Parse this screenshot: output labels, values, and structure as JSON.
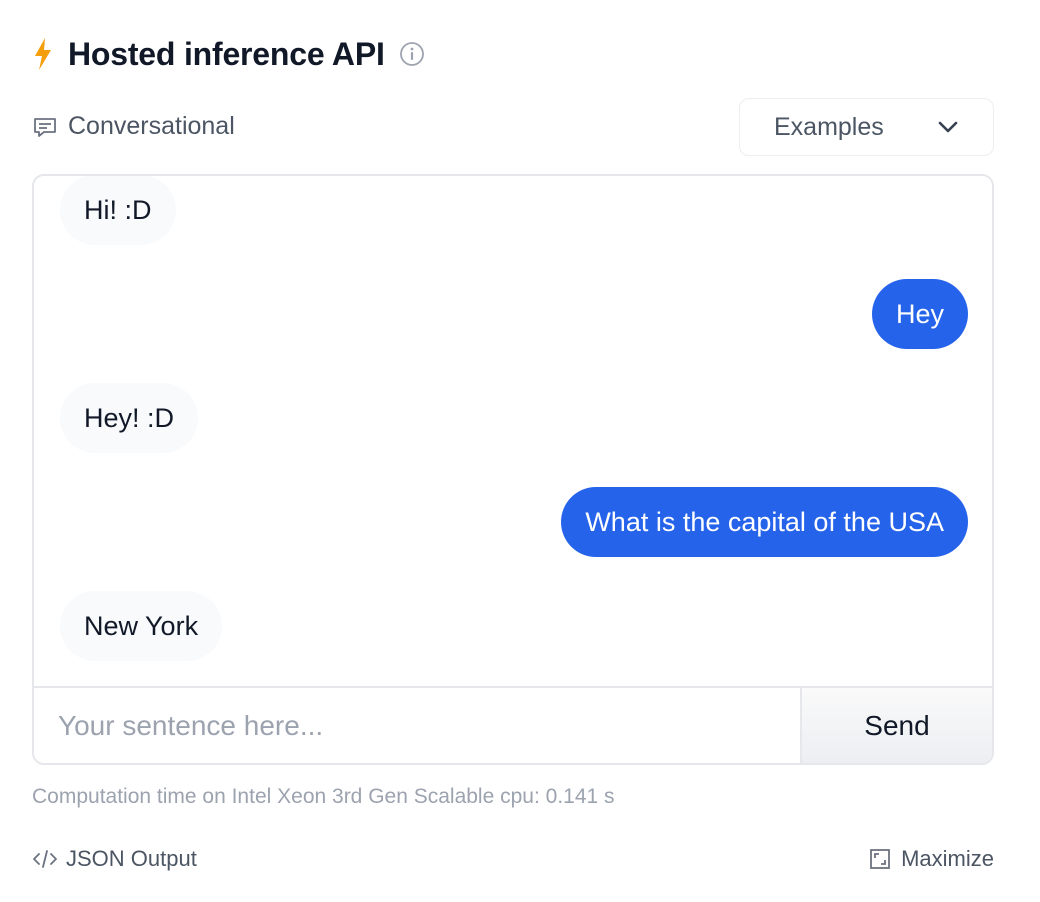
{
  "header": {
    "title": "Hosted inference API",
    "icons": {
      "left": "lightning-bolt-icon",
      "right": "info-icon"
    },
    "accent_color": "#f59e0b"
  },
  "task": {
    "label": "Conversational",
    "icon": "chat-bubble-icon"
  },
  "examples_dropdown": {
    "label": "Examples",
    "icon": "chevron-down-icon"
  },
  "conversation": {
    "messages": [
      {
        "role": "bot",
        "text": "Hi! :D"
      },
      {
        "role": "user",
        "text": "Hey"
      },
      {
        "role": "bot",
        "text": "Hey! :D"
      },
      {
        "role": "user",
        "text": "What is the capital of the USA"
      },
      {
        "role": "bot",
        "text": "New York"
      }
    ],
    "user_bubble_color": "#2563eb",
    "bot_bubble_color": "#f8fafc"
  },
  "input": {
    "placeholder": "Your sentence here...",
    "value": ""
  },
  "send_button": {
    "label": "Send"
  },
  "computation": {
    "text": "Computation time on Intel Xeon 3rd Gen Scalable cpu: 0.141 s"
  },
  "footer": {
    "json_output_label": "JSON Output",
    "maximize_label": "Maximize"
  }
}
